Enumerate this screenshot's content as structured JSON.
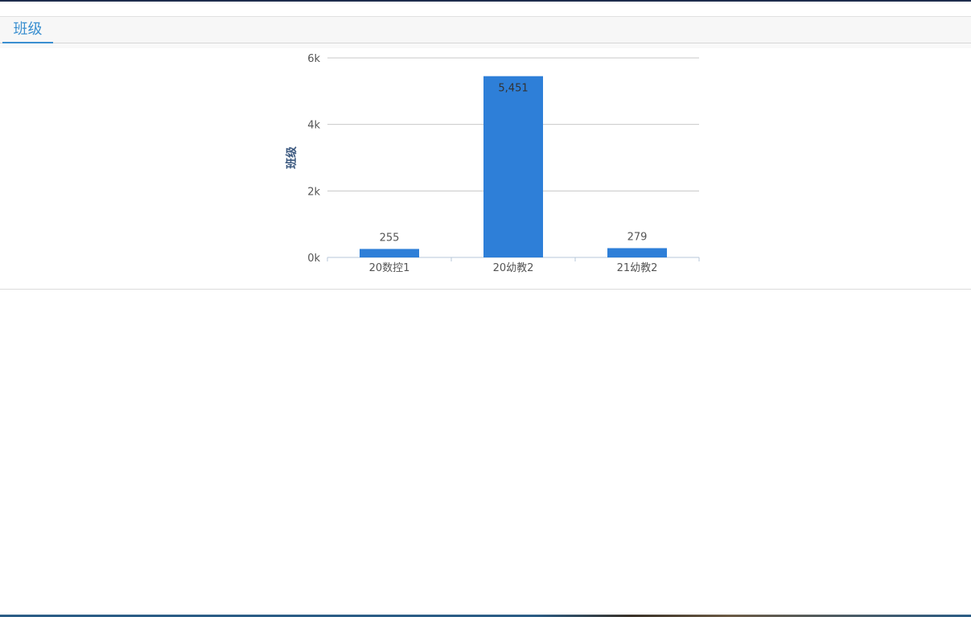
{
  "tab": {
    "label": "班级"
  },
  "chart_data": {
    "type": "bar",
    "categories": [
      "20数控1",
      "20幼教2",
      "21幼教2"
    ],
    "values": [
      255,
      5451,
      279
    ],
    "value_labels": [
      "255",
      "5,451",
      "279"
    ],
    "title": "",
    "xlabel": "",
    "ylabel": "班级",
    "ylim": [
      0,
      6000
    ],
    "y_ticks": [
      0,
      2000,
      4000,
      6000
    ],
    "y_tick_labels": [
      "0k",
      "2k",
      "4k",
      "6k"
    ],
    "grid": true,
    "legend": "none",
    "colors": {
      "bar": "#2e7fd8",
      "grid": "#c8c8c8",
      "axis": "#b7c7d8",
      "tick_text": "#555555",
      "ylabel": "#3d5a80"
    }
  }
}
